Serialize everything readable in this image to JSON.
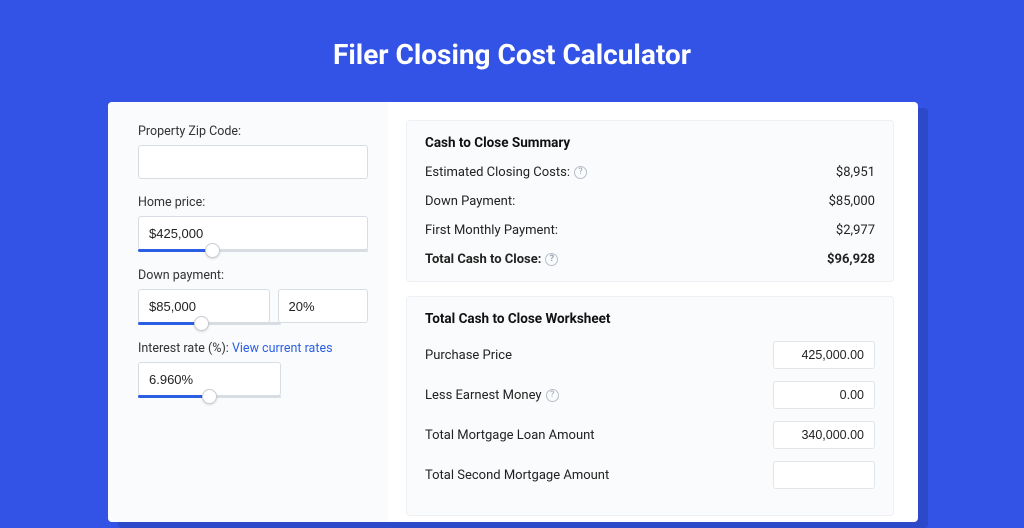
{
  "title": "Filer Closing Cost Calculator",
  "form": {
    "zip_label": "Property Zip Code:",
    "zip_value": "",
    "home_price_label": "Home price:",
    "home_price_value": "$425,000",
    "home_price_slider_pct": 32,
    "down_payment_label": "Down payment:",
    "down_payment_value": "$85,000",
    "down_payment_pct": "20%",
    "down_payment_slider_pct": 44,
    "ir_label": "Interest rate (%): ",
    "ir_link": "View current rates",
    "ir_value": "6.960%",
    "ir_slider_pct": 50
  },
  "summary": {
    "title": "Cash to Close Summary",
    "rows": [
      {
        "label": "Estimated Closing Costs:",
        "help": true,
        "value": "$8,951"
      },
      {
        "label": "Down Payment:",
        "help": false,
        "value": "$85,000"
      },
      {
        "label": "First Monthly Payment:",
        "help": false,
        "value": "$2,977"
      }
    ],
    "total_label": "Total Cash to Close:",
    "total_value": "$96,928"
  },
  "worksheet": {
    "title": "Total Cash to Close Worksheet",
    "rows": [
      {
        "label": "Purchase Price",
        "help": false,
        "value": "425,000.00"
      },
      {
        "label": "Less Earnest Money",
        "help": true,
        "value": "0.00"
      },
      {
        "label": "Total Mortgage Loan Amount",
        "help": false,
        "value": "340,000.00"
      },
      {
        "label": "Total Second Mortgage Amount",
        "help": false,
        "value": ""
      }
    ]
  }
}
